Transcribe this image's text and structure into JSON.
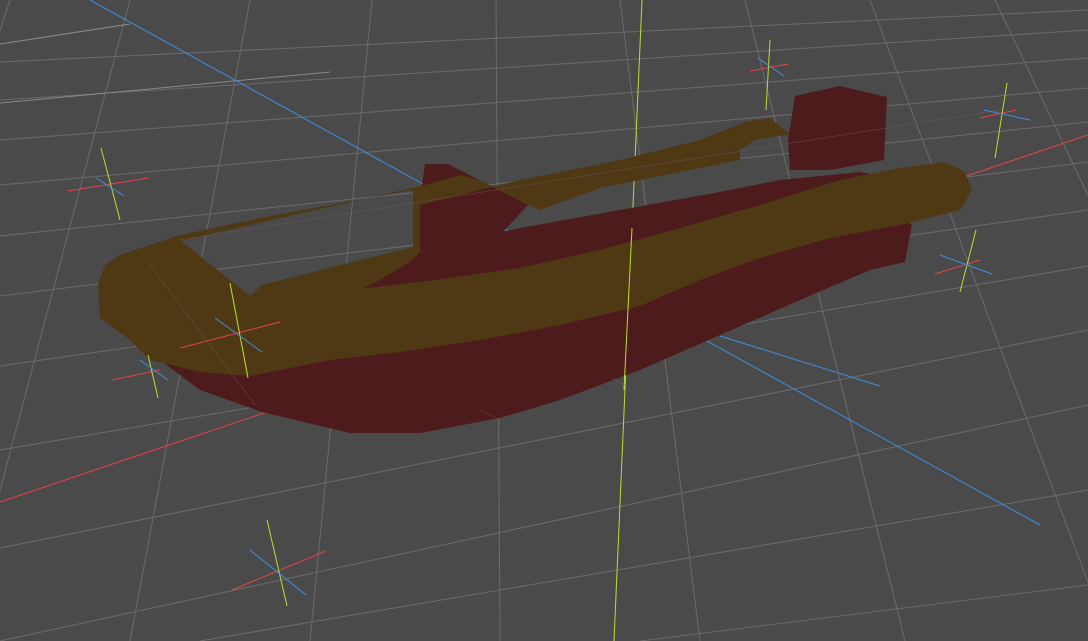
{
  "viewport": {
    "background_color": "#4a4a4a",
    "grid_line_color": "#6a6a6a",
    "grid_major_color": "#8c8c8c",
    "axis_colors": {
      "x": "#e8414b",
      "y": "#b6e22a",
      "z": "#3d8fe0"
    }
  },
  "model": {
    "name_icon": "rubber-boat-mesh",
    "tube_color": "#4f3914",
    "hull_color": "#4e1b1c"
  },
  "gizmos": {
    "count": 8,
    "icon": "transform-gizmo-icon"
  }
}
